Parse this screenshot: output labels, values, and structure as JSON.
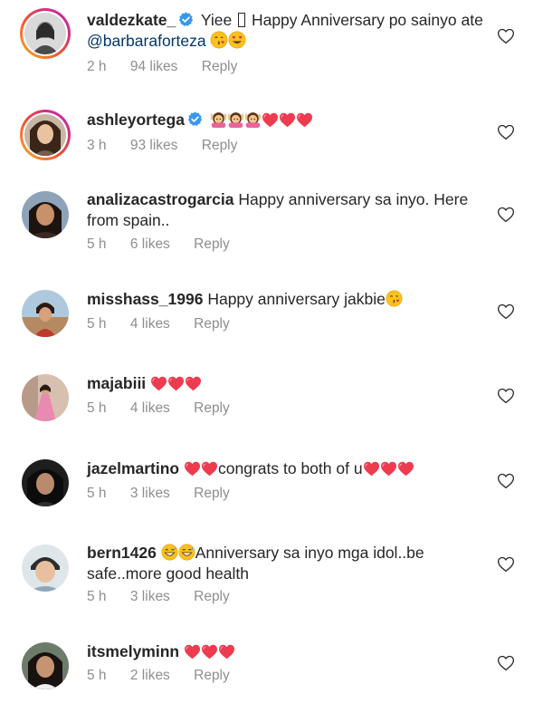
{
  "comments": [
    {
      "username": "valdezkate_",
      "verified": true,
      "text_pre": "Yiee",
      "text_post": "Happy Anniversary po sainyo ate",
      "mention": "@barbaraforteza",
      "time": "2 h",
      "likes": "94 likes",
      "reply": "Reply",
      "emojis": [
        "kissing-face-icon",
        "heart-eyes-face-icon"
      ]
    },
    {
      "username": "ashleyortega",
      "verified": true,
      "time": "3 h",
      "likes": "93 likes",
      "reply": "Reply",
      "emojis": [
        "girl-raising-hands-icon",
        "girl-raising-hands-icon",
        "girl-raising-hands-icon",
        "red-heart-icon",
        "red-heart-icon",
        "red-heart-icon"
      ]
    },
    {
      "username": "analizacastrogarcia",
      "verified": false,
      "text": "Happy anniversary sa inyo. Here from spain..",
      "time": "5 h",
      "likes": "6 likes",
      "reply": "Reply"
    },
    {
      "username": "misshass_1996",
      "verified": false,
      "text": "Happy anniversary jakbie",
      "time": "5 h",
      "likes": "4 likes",
      "reply": "Reply",
      "emojis": [
        "kissing-face-icon"
      ]
    },
    {
      "username": "majabiii",
      "verified": false,
      "time": "5 h",
      "likes": "4 likes",
      "reply": "Reply",
      "emojis": [
        "red-heart-icon",
        "red-heart-icon",
        "red-heart-icon"
      ]
    },
    {
      "username": "jazelmartino",
      "verified": false,
      "text": "congrats to both of u",
      "time": "5 h",
      "likes": "3 likes",
      "reply": "Reply",
      "emojis": [
        "red-heart-icon",
        "red-heart-icon",
        "red-heart-icon",
        "red-heart-icon",
        "red-heart-icon"
      ]
    },
    {
      "username": "bern1426",
      "verified": false,
      "text": "Anniversary sa inyo mga idol..be safe..more good health",
      "time": "5 h",
      "likes": "3 likes",
      "reply": "Reply",
      "emojis": [
        "grinning-sweat-face-icon",
        "grinning-sweat-face-icon"
      ]
    },
    {
      "username": "itsmelyminn",
      "verified": false,
      "time": "5 h",
      "likes": "2 likes",
      "reply": "Reply",
      "emojis": [
        "red-heart-icon",
        "red-heart-icon",
        "red-heart-icon"
      ]
    }
  ],
  "colors": {
    "text": "#262626",
    "meta": "#8e8e8e",
    "mention": "#00376b",
    "verified": "#3897f0",
    "heart": "#ed4956"
  }
}
